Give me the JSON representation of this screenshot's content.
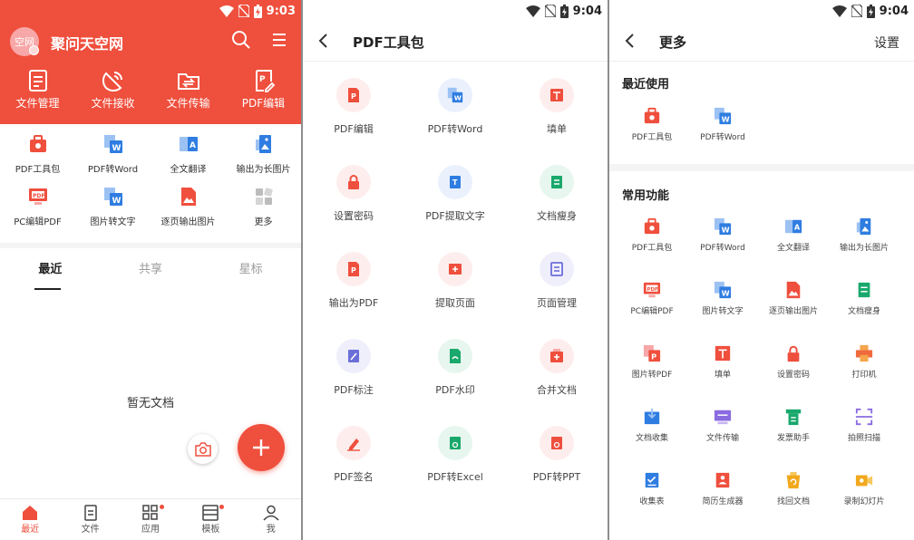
{
  "colors": {
    "brand_red": "#ef4f3d",
    "blue": "#2f7de1",
    "green": "#1aa86c",
    "purple": "#6b6fd8",
    "yellow": "#f2a81d"
  },
  "status": {
    "time1": "9:03",
    "time2": "9:04",
    "time3": "9:04"
  },
  "home": {
    "avatar_text": "空网",
    "app_title": "聚问天空网",
    "top_tiles": [
      {
        "label": "文件管理",
        "icon": "file-manage-icon"
      },
      {
        "label": "文件接收",
        "icon": "satellite-icon"
      },
      {
        "label": "文件传输",
        "icon": "folder-transfer-icon"
      },
      {
        "label": "PDF编辑",
        "icon": "pdf-edit-icon"
      }
    ],
    "tools": [
      {
        "label": "PDF工具包",
        "icon": "pdf-toolkit-icon"
      },
      {
        "label": "PDF转Word",
        "icon": "pdf-to-word-icon"
      },
      {
        "label": "全文翻译",
        "icon": "translate-icon"
      },
      {
        "label": "输出为长图片",
        "icon": "long-image-icon"
      },
      {
        "label": "PC编辑PDF",
        "icon": "pc-pdf-icon"
      },
      {
        "label": "图片转文字",
        "icon": "image-to-text-icon"
      },
      {
        "label": "逐页输出图片",
        "icon": "page-images-icon"
      },
      {
        "label": "更多",
        "icon": "more-grid-icon"
      }
    ],
    "tabs": [
      "最近",
      "共享",
      "星标"
    ],
    "empty_text": "暂无文档",
    "nav": [
      {
        "label": "最近",
        "icon": "home-icon"
      },
      {
        "label": "文件",
        "icon": "file-icon"
      },
      {
        "label": "应用",
        "icon": "apps-icon"
      },
      {
        "label": "模板",
        "icon": "template-icon"
      },
      {
        "label": "我",
        "icon": "user-icon"
      }
    ]
  },
  "pdf_toolkit": {
    "title": "PDF工具包",
    "tools": [
      {
        "label": "PDF编辑",
        "icon": "pdf-edit-icon",
        "color": "red"
      },
      {
        "label": "PDF转Word",
        "icon": "pdf-to-word-icon",
        "color": "blue"
      },
      {
        "label": "填单",
        "icon": "fill-form-icon",
        "color": "red"
      },
      {
        "label": "设置密码",
        "icon": "lock-icon",
        "color": "red"
      },
      {
        "label": "PDF提取文字",
        "icon": "extract-text-icon",
        "color": "blue"
      },
      {
        "label": "文档瘦身",
        "icon": "slim-doc-icon",
        "color": "green"
      },
      {
        "label": "输出为PDF",
        "icon": "export-pdf-icon",
        "color": "red"
      },
      {
        "label": "提取页面",
        "icon": "extract-page-icon",
        "color": "red"
      },
      {
        "label": "页面管理",
        "icon": "page-manage-icon",
        "color": "purple"
      },
      {
        "label": "PDF标注",
        "icon": "annotate-icon",
        "color": "purple"
      },
      {
        "label": "PDF水印",
        "icon": "watermark-icon",
        "color": "green"
      },
      {
        "label": "合并文档",
        "icon": "merge-icon",
        "color": "red"
      },
      {
        "label": "PDF签名",
        "icon": "sign-icon",
        "color": "red"
      },
      {
        "label": "PDF转Excel",
        "icon": "pdf-to-excel-icon",
        "color": "green"
      },
      {
        "label": "PDF转PPT",
        "icon": "pdf-to-ppt-icon",
        "color": "red"
      }
    ]
  },
  "more": {
    "title": "更多",
    "settings": "设置",
    "recent_title": "最近使用",
    "recent": [
      {
        "label": "PDF工具包",
        "icon": "pdf-toolkit-icon",
        "color": "red"
      },
      {
        "label": "PDF转Word",
        "icon": "pdf-to-word-icon",
        "color": "blue"
      }
    ],
    "common_title": "常用功能",
    "common": [
      {
        "label": "PDF工具包",
        "icon": "pdf-toolkit-icon",
        "color": "red"
      },
      {
        "label": "PDF转Word",
        "icon": "pdf-to-word-icon",
        "color": "blue"
      },
      {
        "label": "全文翻译",
        "icon": "translate-icon",
        "color": "blue"
      },
      {
        "label": "输出为长图片",
        "icon": "long-image-icon",
        "color": "blue"
      },
      {
        "label": "PC编辑PDF",
        "icon": "pc-pdf-icon",
        "color": "red"
      },
      {
        "label": "图片转文字",
        "icon": "image-to-text-icon",
        "color": "blue"
      },
      {
        "label": "逐页输出图片",
        "icon": "page-images-icon",
        "color": "red"
      },
      {
        "label": "文档瘦身",
        "icon": "slim-doc-icon",
        "color": "green"
      },
      {
        "label": "图片转PDF",
        "icon": "image-to-pdf-icon",
        "color": "red"
      },
      {
        "label": "填单",
        "icon": "fill-form-icon",
        "color": "red"
      },
      {
        "label": "设置密码",
        "icon": "lock-icon",
        "color": "red"
      },
      {
        "label": "打印机",
        "icon": "printer-icon",
        "color": "orange"
      },
      {
        "label": "文档收集",
        "icon": "collect-icon",
        "color": "blue"
      },
      {
        "label": "文件传输",
        "icon": "transfer-icon",
        "color": "purple"
      },
      {
        "label": "发票助手",
        "icon": "invoice-icon",
        "color": "green"
      },
      {
        "label": "拍照扫描",
        "icon": "scan-icon",
        "color": "purple"
      },
      {
        "label": "收集表",
        "icon": "form-icon",
        "color": "blue"
      },
      {
        "label": "简历生成器",
        "icon": "resume-icon",
        "color": "red"
      },
      {
        "label": "找回文档",
        "icon": "recover-icon",
        "color": "yellow"
      },
      {
        "label": "录制幻灯片",
        "icon": "record-slide-icon",
        "color": "yellow"
      }
    ]
  }
}
